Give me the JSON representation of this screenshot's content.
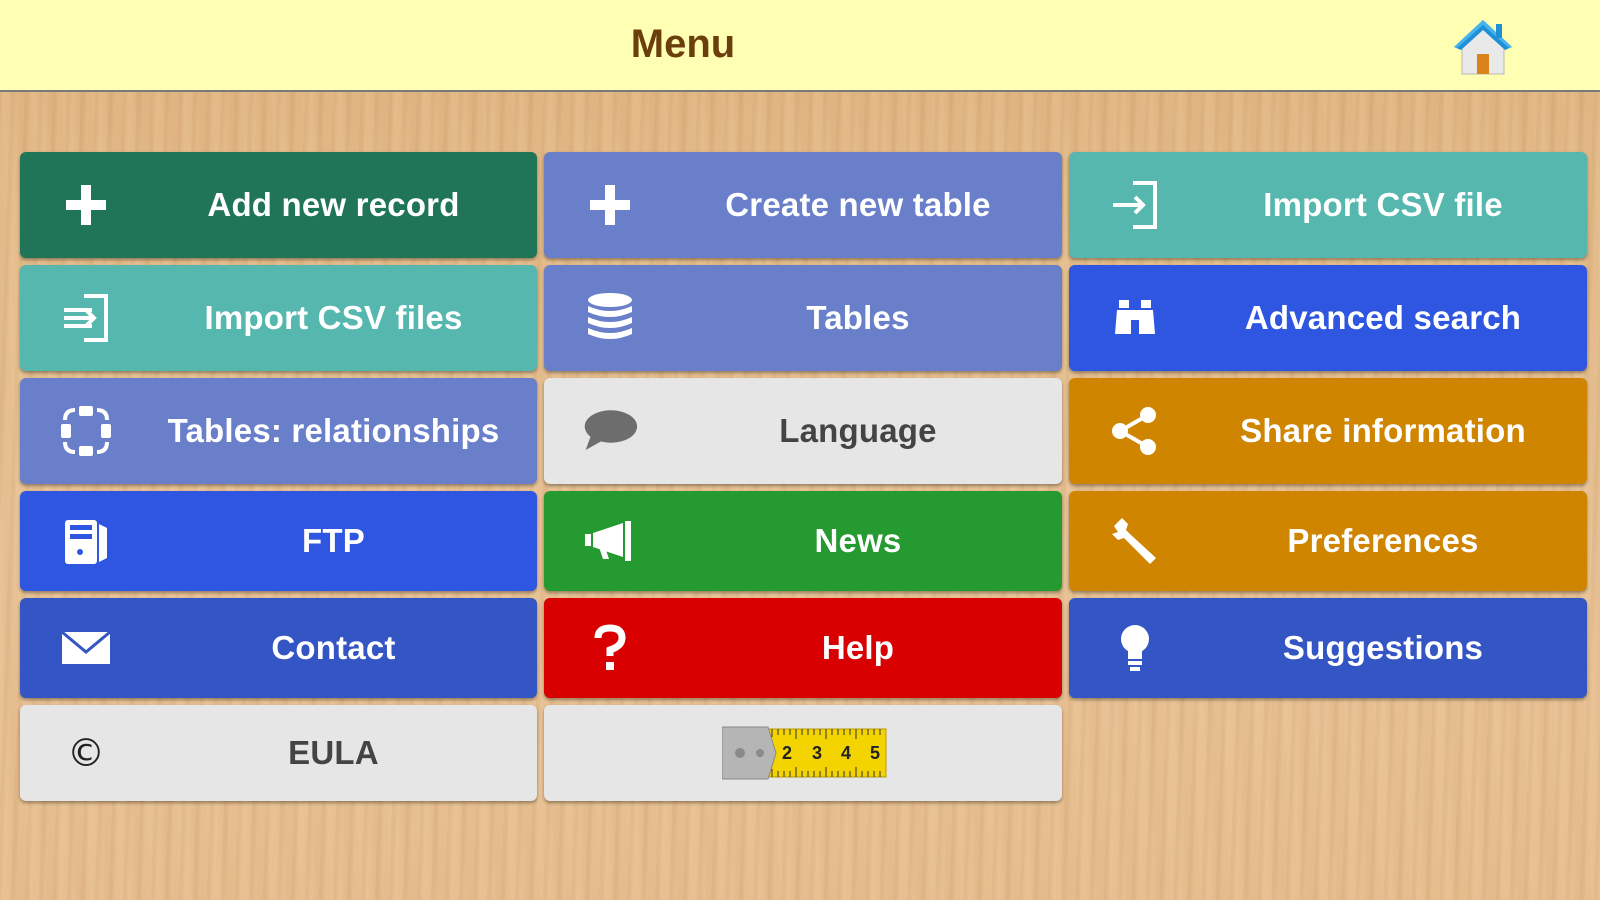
{
  "header": {
    "title": "Menu",
    "home_icon": "home-icon"
  },
  "tiles": {
    "add_new_record": {
      "label": "Add new record",
      "icon": "plus-icon",
      "color": "#207558"
    },
    "create_new_table": {
      "label": "Create new table",
      "icon": "plus-icon",
      "color": "#6a7fca"
    },
    "import_csv_file": {
      "label": "Import CSV file",
      "icon": "import-icon",
      "color": "#55b7ad"
    },
    "import_csv_files": {
      "label": "Import CSV files",
      "icon": "import-multiple-icon",
      "color": "#55b7ad"
    },
    "tables": {
      "label": "Tables",
      "icon": "database-icon",
      "color": "#6a7fca"
    },
    "advanced_search": {
      "label": "Advanced search",
      "icon": "binoculars-icon",
      "color": "#2f56e0"
    },
    "tables_relationships": {
      "label": "Tables: relationships",
      "icon": "relationship-icon",
      "color": "#6a7fca"
    },
    "language": {
      "label": "Language",
      "icon": "speech-bubble-icon",
      "color": "#e6e6e6"
    },
    "share_information": {
      "label": "Share information",
      "icon": "share-icon",
      "color": "#cf8500"
    },
    "ftp": {
      "label": "FTP",
      "icon": "server-icon",
      "color": "#2f56e0"
    },
    "news": {
      "label": "News",
      "icon": "megaphone-icon",
      "color": "#259a30"
    },
    "preferences": {
      "label": "Preferences",
      "icon": "wrench-icon",
      "color": "#cf8500"
    },
    "contact": {
      "label": "Contact",
      "icon": "envelope-icon",
      "color": "#3455c4"
    },
    "help": {
      "label": "Help",
      "icon": "question-icon",
      "color": "#d80000"
    },
    "suggestions": {
      "label": "Suggestions",
      "icon": "lightbulb-icon",
      "color": "#3455c4"
    },
    "eula": {
      "label": "EULA",
      "icon_glyph": "©",
      "icon": "copyright-icon",
      "color": "#e6e6e6"
    },
    "measure": {
      "icon": "tape-measure-icon",
      "tape_numbers": [
        "2",
        "3",
        "4",
        "5"
      ],
      "color": "#e6e6e6"
    }
  }
}
